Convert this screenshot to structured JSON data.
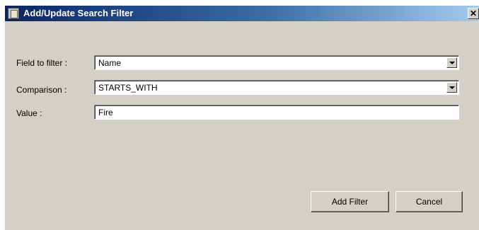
{
  "window": {
    "title": "Add/Update Search Filter",
    "close_glyph": "✕",
    "icon": "app-window-icon"
  },
  "form": {
    "field_label": "Field to filter :",
    "field_value": "Name",
    "comparison_label": "Comparison :",
    "comparison_value": "STARTS_WITH",
    "value_label": "Value :",
    "value_text": "Fire"
  },
  "buttons": {
    "add_filter": "Add Filter",
    "cancel": "Cancel"
  },
  "colors": {
    "dialog_face": "#d4d0c8",
    "title_start": "#0a246a",
    "title_end": "#a6caf0"
  }
}
